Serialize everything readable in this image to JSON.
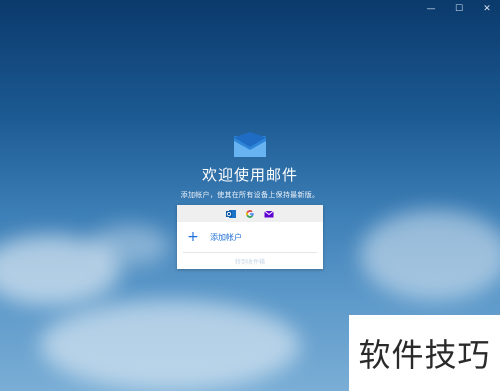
{
  "window": {
    "controls": {
      "minimize_glyph": "—",
      "maximize_glyph": "☐",
      "close_glyph": "✕"
    }
  },
  "welcome": {
    "title": "欢迎使用邮件",
    "subtitle": "添加帐户，使其在所有设备上保持最新版。"
  },
  "card": {
    "providers": [
      "outlook-icon",
      "google-icon",
      "yahoo-mail-icon"
    ],
    "add_account_label": "添加帐户",
    "ready_label": "转到收件箱"
  },
  "watermark": {
    "text": "软件技巧"
  },
  "colors": {
    "accent": "#1e6fd6",
    "background_top": "#0b3a6c",
    "background_bottom": "#7aaed6"
  }
}
